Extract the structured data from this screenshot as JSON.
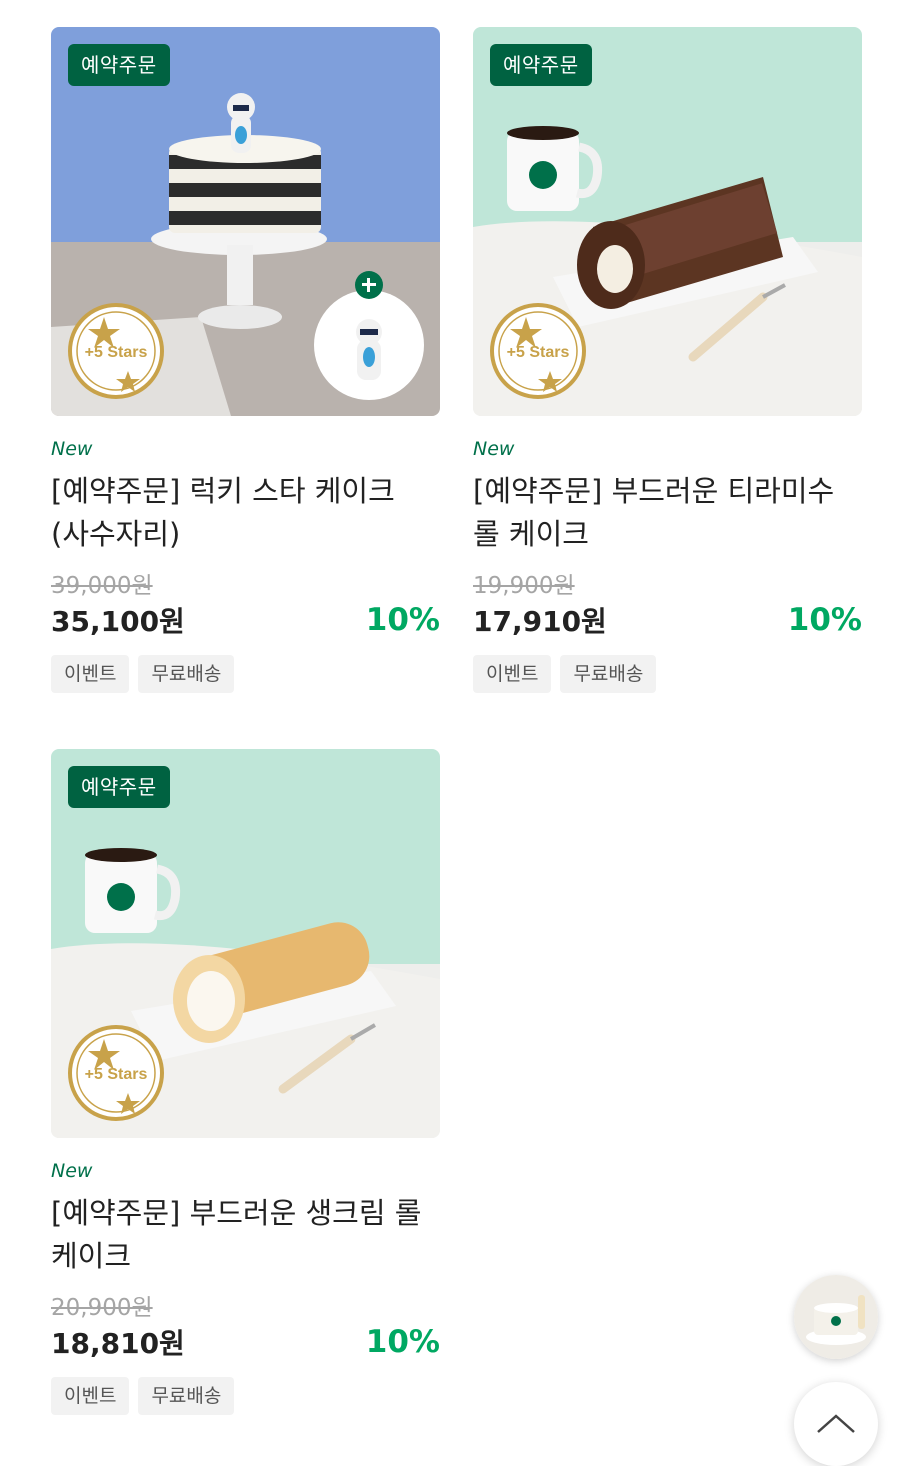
{
  "products": [
    {
      "badge": "예약주문",
      "new_label": "New",
      "title": "[예약주문] 럭키 스타 케이크 (사수자리)",
      "original_price": "39,000원",
      "price": "35,100원",
      "discount": "10%",
      "tags": [
        "이벤트",
        "무료배송"
      ],
      "seal_text": "+5 Stars"
    },
    {
      "badge": "예약주문",
      "new_label": "New",
      "title": "[예약주문] 부드러운 티라미수 롤 케이크",
      "original_price": "19,900원",
      "price": "17,910원",
      "discount": "10%",
      "tags": [
        "이벤트",
        "무료배송"
      ],
      "seal_text": "+5 Stars"
    },
    {
      "badge": "예약주문",
      "new_label": "New",
      "title": "[예약주문] 부드러운 생크림 롤 케이크",
      "original_price": "20,900원",
      "price": "18,810원",
      "discount": "10%",
      "tags": [
        "이벤트",
        "무료배송"
      ],
      "seal_text": "+5 Stars"
    }
  ],
  "colors": {
    "brand_green": "#006241",
    "discount_green": "#00a862",
    "new_green": "#00704a",
    "seal_gold": "#c8a24a"
  },
  "icons": {
    "scroll_top": "chevron-up-icon",
    "seal": "stars-seal-icon"
  }
}
